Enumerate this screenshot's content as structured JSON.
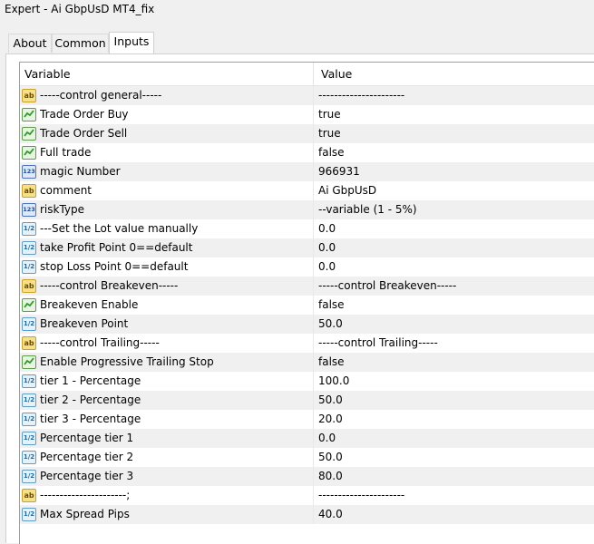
{
  "window": {
    "title": "Expert - Ai GbpUsD MT4_fix"
  },
  "tabs": [
    {
      "label": "About"
    },
    {
      "label": "Common"
    },
    {
      "label": "Inputs"
    }
  ],
  "table": {
    "headers": {
      "variable": "Variable",
      "value": "Value"
    },
    "rows": [
      {
        "type": "string",
        "variable": "-----control general-----",
        "value": "----------------------"
      },
      {
        "type": "bool",
        "variable": "Trade Order Buy",
        "value": "true"
      },
      {
        "type": "bool",
        "variable": "Trade Order Sell",
        "value": "true"
      },
      {
        "type": "bool",
        "variable": "Full trade",
        "value": "false"
      },
      {
        "type": "int",
        "variable": "magic Number",
        "value": "966931"
      },
      {
        "type": "string",
        "variable": "comment",
        "value": "Ai GbpUsD"
      },
      {
        "type": "int",
        "variable": "riskType",
        "value": "--variable (1 - 5%)"
      },
      {
        "type": "double",
        "variable": "---Set the Lot value manually",
        "value": "0.0"
      },
      {
        "type": "double",
        "variable": "take Profit Point 0==default",
        "value": "0.0"
      },
      {
        "type": "double",
        "variable": "stop Loss Point  0==default",
        "value": "0.0"
      },
      {
        "type": "string",
        "variable": "-----control Breakeven-----",
        "value": "-----control Breakeven-----"
      },
      {
        "type": "bool",
        "variable": "Breakeven Enable",
        "value": "false"
      },
      {
        "type": "double",
        "variable": "Breakeven Point",
        "value": "50.0"
      },
      {
        "type": "string",
        "variable": "-----control Trailing-----",
        "value": "-----control Trailing-----"
      },
      {
        "type": "bool",
        "variable": "Enable Progressive Trailing Stop",
        "value": "false"
      },
      {
        "type": "double",
        "variable": "tier 1 - Percentage",
        "value": "100.0"
      },
      {
        "type": "double",
        "variable": "tier 2 - Percentage",
        "value": "50.0"
      },
      {
        "type": "double",
        "variable": "tier 3 - Percentage",
        "value": "20.0"
      },
      {
        "type": "double",
        "variable": "Percentage tier 1",
        "value": "0.0"
      },
      {
        "type": "double",
        "variable": "Percentage tier 2",
        "value": "50.0"
      },
      {
        "type": "double",
        "variable": "Percentage tier 3",
        "value": "80.0"
      },
      {
        "type": "string",
        "variable": "----------------------;",
        "value": "----------------------"
      },
      {
        "type": "double",
        "variable": "Max Spread Pips",
        "value": "40.0"
      }
    ]
  },
  "icons": {
    "string": {
      "name": "string-type-icon",
      "glyph": "ab"
    },
    "bool": {
      "name": "bool-type-icon",
      "glyph": ""
    },
    "int": {
      "name": "integer-type-icon",
      "glyph": "123"
    },
    "double": {
      "name": "double-type-icon",
      "glyph": "1/2"
    }
  }
}
